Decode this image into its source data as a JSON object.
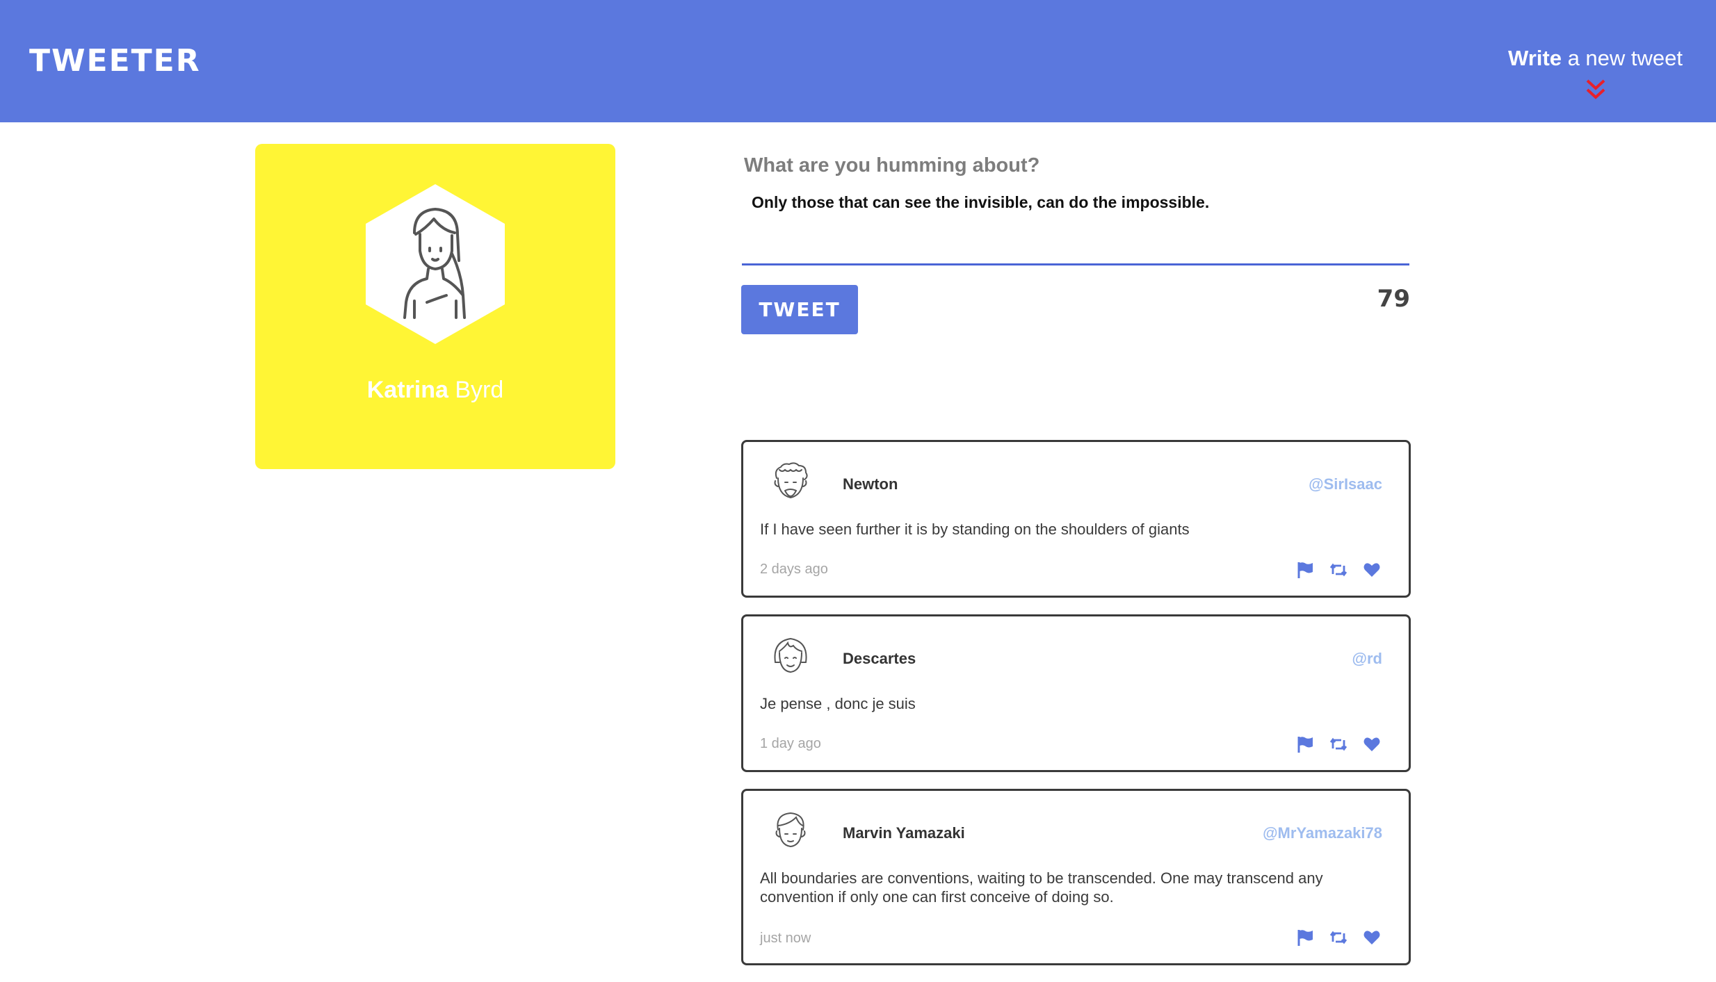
{
  "nav": {
    "logo": "TWEETER",
    "compose_toggle_bold": "Write",
    "compose_toggle_rest": " a new tweet",
    "chevron_icon": "double-chevron-down",
    "chevron_color": "#e8202a",
    "background_color": "#5b78de"
  },
  "profile": {
    "first_name": "Katrina",
    "last_name": " Byrd",
    "avatar_icon": "woman-avatar",
    "card_color": "#fff535"
  },
  "compose": {
    "label": "What are you humming about?",
    "value": "Only those that can see the invisible, can do the impossible.",
    "button_label": "TWEET",
    "char_counter": "79"
  },
  "tweets": [
    {
      "avatar_icon": "curly-hair-man-avatar",
      "author": "Newton",
      "handle": "@SirIsaac",
      "text": "If I have seen further it is by standing on the shoulders of giants",
      "time": "2 days ago",
      "actions": [
        "flag-icon",
        "retweet-icon",
        "heart-icon"
      ]
    },
    {
      "avatar_icon": "bob-hair-avatar",
      "author": "Descartes",
      "handle": "@rd",
      "text": "Je pense , donc je suis",
      "time": "1 day ago",
      "actions": [
        "flag-icon",
        "retweet-icon",
        "heart-icon"
      ]
    },
    {
      "avatar_icon": "young-man-avatar",
      "author": "Marvin Yamazaki",
      "handle": "@MrYamazaki78",
      "text": "All boundaries are conventions, waiting to be transcended. One may transcend any convention if only one can first conceive of doing so.",
      "time": "just now",
      "actions": [
        "flag-icon",
        "retweet-icon",
        "heart-icon"
      ]
    }
  ],
  "colors": {
    "accent": "#5b78de",
    "handle": "#9ebcef",
    "action_icon": "#5b78de"
  }
}
